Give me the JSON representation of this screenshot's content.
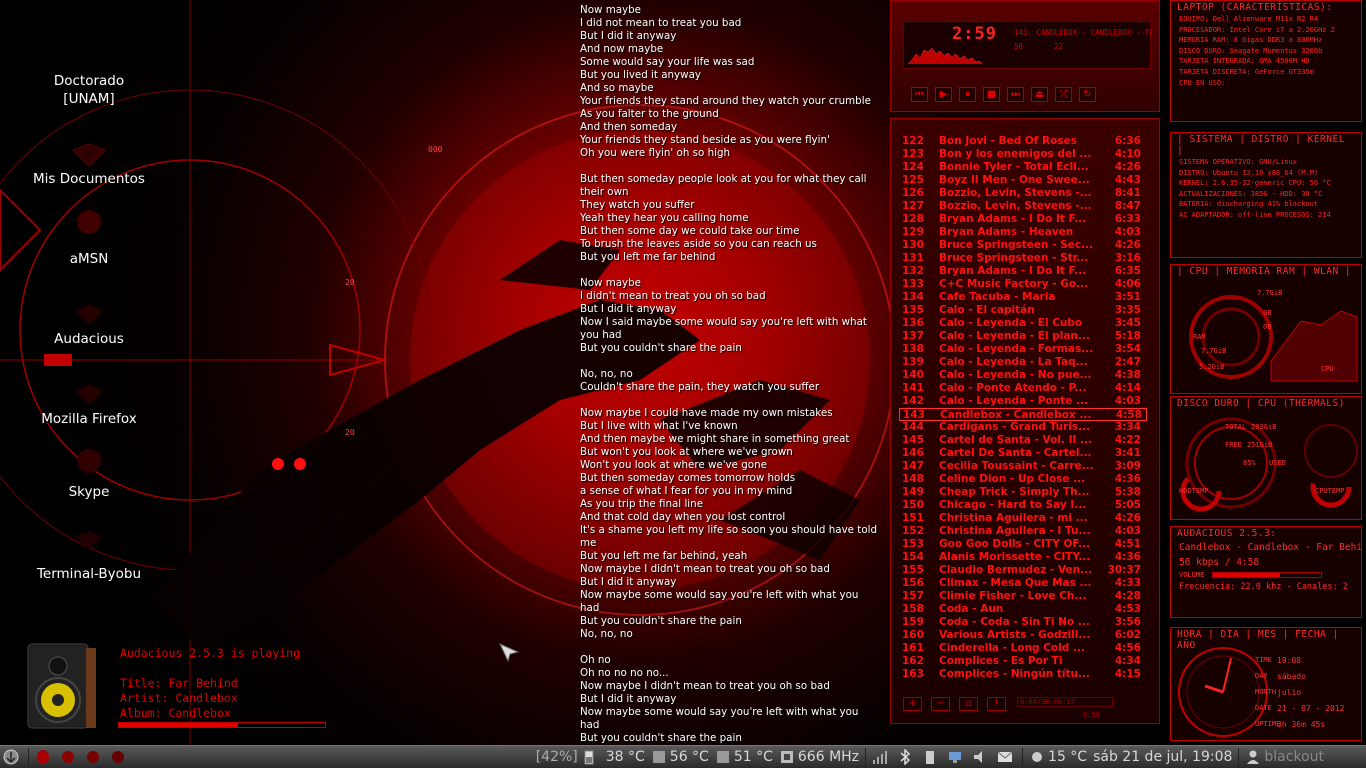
{
  "desktop": {
    "icons": [
      {
        "label1": "Doctorado",
        "label2": "[UNAM]",
        "icon": "folder-icon"
      },
      {
        "label1": "Mis Documentos",
        "label2": "",
        "icon": "folder-icon"
      },
      {
        "label1": "aMSN",
        "label2": "",
        "icon": "amsn-icon"
      },
      {
        "label1": "Audacious",
        "label2": "",
        "icon": "audacious-icon"
      },
      {
        "label1": "Mozilla Firefox",
        "label2": "",
        "icon": "firefox-icon"
      },
      {
        "label1": "Skype",
        "label2": "",
        "icon": "skype-icon"
      },
      {
        "label1": "Terminal-Byobu",
        "label2": "",
        "icon": "terminal-icon"
      }
    ]
  },
  "lyrics": "Now maybe\nI did not mean to treat you bad\nBut I did it anyway\nAnd now maybe\nSome would say your life was sad\nBut you lived it anyway\nAnd so maybe\nYour friends they stand around they watch your crumble\nAs you falter to the ground\nAnd then someday\nYour friends they stand beside as you were flyin'\nOh you were flyin' oh so high\n\nBut then someday people look at you for what they call their own\nThey watch you suffer\nYeah they hear you calling home\nBut then some day we could take our time\nTo brush the leaves aside so you can reach us\nBut you left me far behind\n\nNow maybe\nI didn't mean to treat you oh so bad\nBut I did it anyway\nNow I said maybe some would say you're left with what you had\nBut you couldn't share the pain\n\nNo, no, no\nCouldn't share the pain, they watch you suffer\n\nNow maybe I could have made my own mistakes\nBut I live with what I've known\nAnd then maybe we might share in something great\nBut won't you look at where we've grown\nWon't you look at where we've gone\nBut then someday comes tomorrow holds\na sense of what I fear for you in my mind\nAs you trip the final line\nAnd that cold day when you lost control\nIt's a shame you left my life so soon you should have told me\nBut you left me far behind, yeah\nNow maybe I didn't mean to treat you oh so bad\nBut I did it anyway\nNow maybe some would say you're left with what you had\nBut you couldn't share the pain\nNo, no, no\n\nOh no\nOh no no no no...\nNow maybe I didn't mean to treat you oh so bad\nBut I did it anyway\nNow maybe some would say you're left with what you had\nBut you couldn't share the pain\nI said times have changed your friends\nThey come and watch you crumble to the ground",
  "audacious_widget": {
    "status": "Audacious 2.5.3 is playing",
    "title_line": "Title: Far Behind",
    "artist_line": "Artist: Candlebox",
    "album_line": "Album: Candlebox",
    "progress": 0.58
  },
  "player": {
    "time": "2:59",
    "marquee": "143. CANDLEBOX - CANDLEBOX - FA",
    "kbps": "56",
    "khz": "22",
    "controls": [
      "prev",
      "play",
      "pause",
      "stop",
      "next",
      "eject"
    ],
    "playlist": [
      {
        "n": "122",
        "t": "Bon Jovi - Bed Of Roses",
        "d": "6:36"
      },
      {
        "n": "123",
        "t": "Bon y los enemigos del ...",
        "d": "4:10"
      },
      {
        "n": "124",
        "t": "Bonnie Tyler - Total Ecli...",
        "d": "4:26"
      },
      {
        "n": "125",
        "t": "Boyz II Men - One Swee...",
        "d": "4:43"
      },
      {
        "n": "126",
        "t": "Bozzio, Levin, Stevens -...",
        "d": "8:41"
      },
      {
        "n": "127",
        "t": "Bozzio, Levin, Stevens -...",
        "d": "8:47"
      },
      {
        "n": "128",
        "t": "Bryan Adams - I Do It F...",
        "d": "6:33"
      },
      {
        "n": "129",
        "t": "Bryan Adams - Heaven",
        "d": "4:03"
      },
      {
        "n": "130",
        "t": "Bruce Springsteen - Sec...",
        "d": "4:26"
      },
      {
        "n": "131",
        "t": "Bruce Springsteen - Str...",
        "d": "3:16"
      },
      {
        "n": "132",
        "t": "Bryan Adams - I Do It F...",
        "d": "6:35"
      },
      {
        "n": "133",
        "t": "C+C Music Factory - Go...",
        "d": "4:06"
      },
      {
        "n": "134",
        "t": "Cafe Tacuba - Maria",
        "d": "3:51"
      },
      {
        "n": "135",
        "t": "Calo - El capitán",
        "d": "3:35"
      },
      {
        "n": "136",
        "t": "Calo - Leyenda - El Cubo",
        "d": "3:45"
      },
      {
        "n": "137",
        "t": "Calo - Leyenda - El plan...",
        "d": "5:18"
      },
      {
        "n": "138",
        "t": "Calo - Leyenda - Formas...",
        "d": "3:54"
      },
      {
        "n": "139",
        "t": "Calo - Leyenda - La Taq...",
        "d": "2:47"
      },
      {
        "n": "140",
        "t": "Calo - Leyenda - No pue...",
        "d": "4:38"
      },
      {
        "n": "141",
        "t": "Calo - Ponte Atendo - P...",
        "d": "4:14"
      },
      {
        "n": "142",
        "t": "Calo - Leyenda - Ponte ...",
        "d": "4:03"
      },
      {
        "n": "143",
        "t": "Candlebox - Candlebox ...",
        "d": "4:58"
      },
      {
        "n": "144",
        "t": "Cardigans - Grand Turis...",
        "d": "3:34"
      },
      {
        "n": "145",
        "t": "Cartel de Santa - Vol. II ...",
        "d": "4:22"
      },
      {
        "n": "146",
        "t": "Cartel De Santa - Cartel...",
        "d": "3:41"
      },
      {
        "n": "147",
        "t": "Cecilia Toussaint - Carre...",
        "d": "3:09"
      },
      {
        "n": "148",
        "t": "Celine Dion - Up Close ...",
        "d": "4:36"
      },
      {
        "n": "149",
        "t": "Cheap Trick - Simply Th...",
        "d": "5:38"
      },
      {
        "n": "150",
        "t": "Chicago - Hard to Say I...",
        "d": "5:05"
      },
      {
        "n": "151",
        "t": "Christina Aguilera - mi ...",
        "d": "4:26"
      },
      {
        "n": "152",
        "t": "Christina Aguilera - I Tu...",
        "d": "4:03"
      },
      {
        "n": "153",
        "t": "Goo Goo Dolls - CITY OF...",
        "d": "4:51"
      },
      {
        "n": "154",
        "t": "Alanis Morissette - CITY...",
        "d": "4:36"
      },
      {
        "n": "155",
        "t": "Claudio Bermudez - Ven...",
        "d": "30:37"
      },
      {
        "n": "156",
        "t": "Climax - Mesa Que Mas ...",
        "d": "4:33"
      },
      {
        "n": "157",
        "t": "Climie Fisher - Love Ch...",
        "d": "4:28"
      },
      {
        "n": "158",
        "t": "Coda - Aun",
        "d": "4:53"
      },
      {
        "n": "159",
        "t": "Coda - Coda - Sin Ti No ...",
        "d": "3:56"
      },
      {
        "n": "160",
        "t": "Various Artists - Godzill...",
        "d": "6:02"
      },
      {
        "n": "161",
        "t": "Cinderella - Long Cold ...",
        "d": "4:56"
      },
      {
        "n": "162",
        "t": "Complices - Es Por Ti",
        "d": "4:34"
      },
      {
        "n": "163",
        "t": "Complices - Ningún títu...",
        "d": "4:15"
      }
    ],
    "current_index": 21,
    "list_timebox": "0:00/38:08:15",
    "list_timebox2": "8:59"
  },
  "panels": {
    "laptop": {
      "title": "LAPTOP (CARACTERÍSTICAS):",
      "lines": [
        "EQUIPO: Dell Alienware M11x R2 R4",
        "PROCESADOR: Intel Core i7 a 2.26GHz 2",
        "MEMORIA RAM: 8 Gigas DDR3 a 800MHz",
        "DISCO DURO: Seagate Momentus 320Gb",
        "TARJETA INTEGRADA: GMA 4500M HD",
        "TARJETA DISCRETA: GeForce GT335m",
        "CPU EN USO:"
      ]
    },
    "sistema": {
      "title": "| SISTEMA | DISTRO | KERNEL |",
      "lines": [
        "SISTEMA OPERATIVO: GNU/Linux",
        "DISTRO: Ubuntu 12.10 x86_64 (M.M)",
        "KERNEL: 2.6.35-32-generic CPU: 56 °C",
        "ACTUALIZACIONES: 3856 - HDD: 38 °C",
        "BATERIA: discharging 41% blackout",
        "AC ADAPTADOR: off-line PROCESOS: 214"
      ]
    },
    "cpu": {
      "title": "| CPU | MEMORIA RAM | WLAN |",
      "labels": [
        "7.7GiB",
        "0B",
        "0B",
        "RAM",
        "7.7GiB",
        "CPU",
        "5.2GiB"
      ]
    },
    "disco": {
      "title": "DISCO DURO | CPU (THERMALS)",
      "labels": [
        "TOTAL",
        "293GiB",
        "FREE",
        "251GiB",
        "85%",
        "USED",
        "HDDTEMP",
        "CPUTEMP"
      ]
    },
    "audacious": {
      "title": "AUDACIOUS 2.5.3:",
      "track": "Candlebox - Candlebox - Far Behind",
      "bitrate": "56 kbps / 4:58",
      "volume_label": "VOLUME",
      "volume": 0.62,
      "freq": "Frecuencia: 22.0 khz - Canales: 2"
    },
    "hora": {
      "title": "HORA | DIA | MES | FECHA | AÑO",
      "rows": [
        {
          "k": "TIME",
          "v": "19:08"
        },
        {
          "k": "DAY",
          "v": "sábado"
        },
        {
          "k": "MONTH",
          "v": "julio"
        },
        {
          "k": "DATE",
          "v": "21 - 07 - 2012"
        },
        {
          "k": "UPTIME",
          "v": "3h 36m 45s"
        }
      ]
    }
  },
  "taskbar": {
    "battery": "[42%]",
    "hdd_temp": "38 °C",
    "cpu_temp": "56 °C",
    "gpu_temp": "51 °C",
    "cpu_freq": "666 MHz",
    "weather": "15 °C",
    "clock": "sáb 21 de jul, 19:08",
    "user": "blackout"
  },
  "colors": {
    "accent": "#e00000",
    "panel_border": "#c00000",
    "taskbar": "#3a3a3a"
  }
}
